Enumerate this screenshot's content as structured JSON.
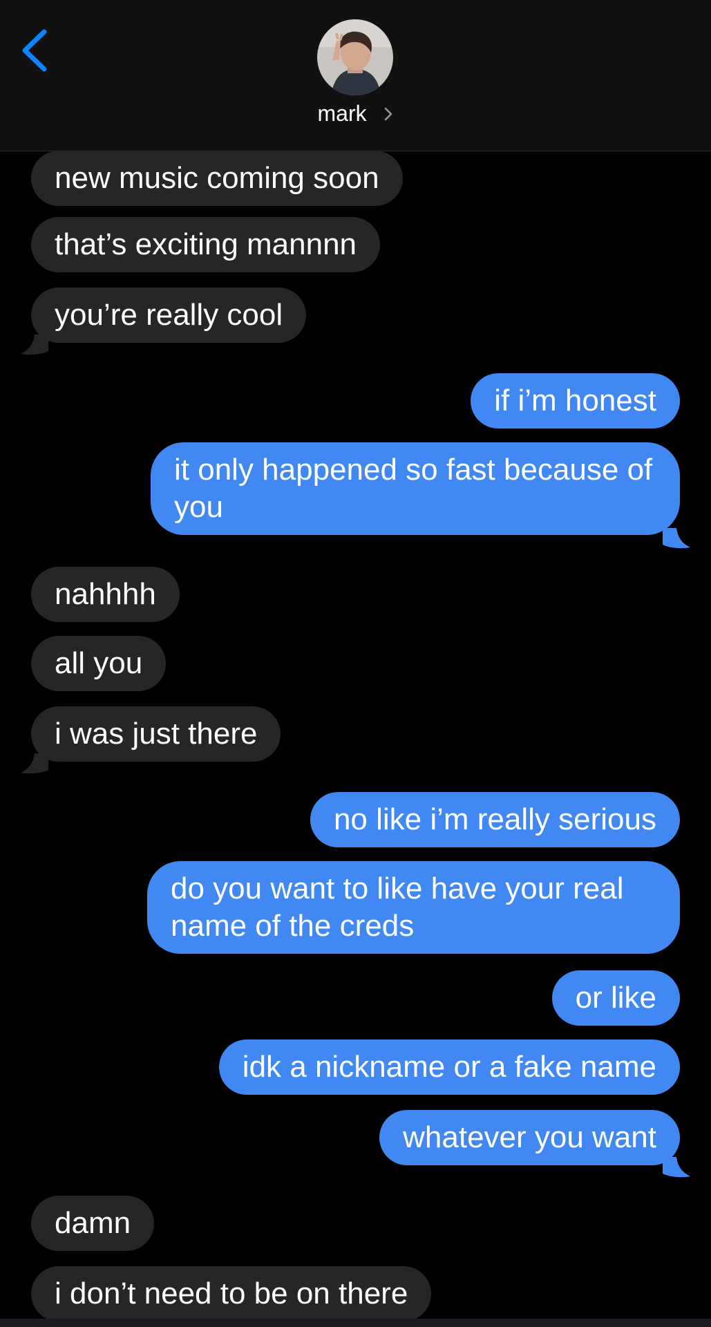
{
  "header": {
    "contact_name": "mark",
    "back_icon": "chevron-left-icon",
    "accent_color": "#0a84ff"
  },
  "colors": {
    "incoming_bubble": "#262628",
    "outgoing_bubble": "#4188f3",
    "background": "#000000"
  },
  "messages": [
    {
      "from": "them",
      "text": "new music coming soon"
    },
    {
      "from": "them",
      "text": "that’s exciting mannnn"
    },
    {
      "from": "them",
      "text": "you’re really cool"
    },
    {
      "from": "me",
      "text": "if i’m honest"
    },
    {
      "from": "me",
      "text": "it only happened so fast because of you"
    },
    {
      "from": "them",
      "text": "nahhhh"
    },
    {
      "from": "them",
      "text": "all you"
    },
    {
      "from": "them",
      "text": "i was just there"
    },
    {
      "from": "me",
      "text": "no like i’m really serious"
    },
    {
      "from": "me",
      "text": "do you want to like have your real name of the creds"
    },
    {
      "from": "me",
      "text": "or like"
    },
    {
      "from": "me",
      "text": "idk a nickname or a fake name"
    },
    {
      "from": "me",
      "text": "whatever you want"
    },
    {
      "from": "them",
      "text": "damn"
    },
    {
      "from": "them",
      "text": "i don’t need to be on there"
    }
  ]
}
